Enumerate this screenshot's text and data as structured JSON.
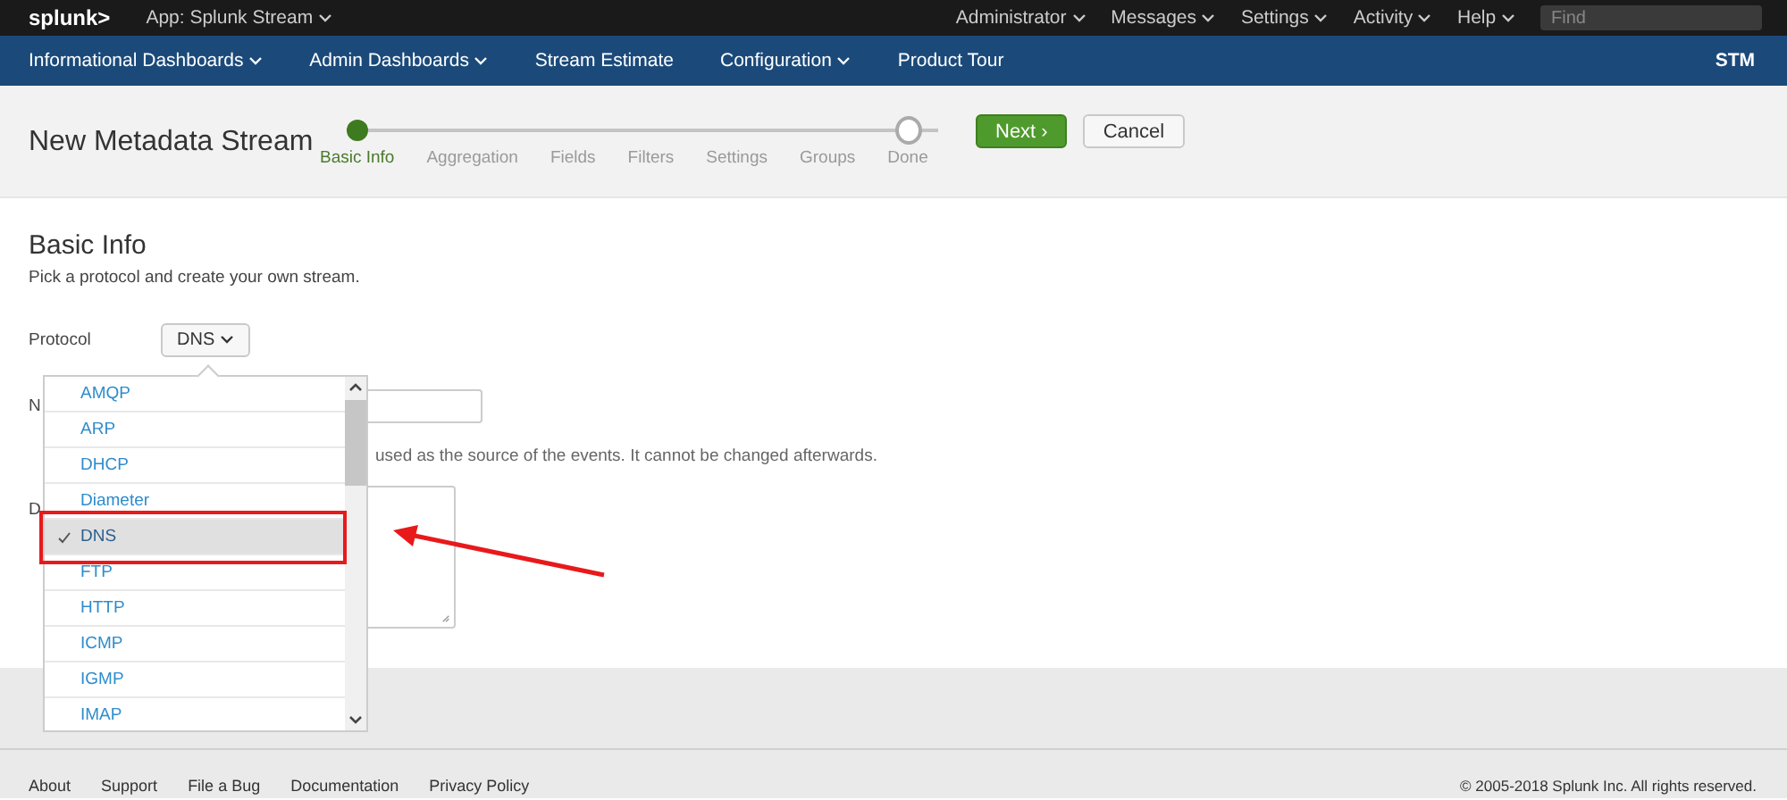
{
  "top_bar": {
    "logo": "splunk>",
    "app": "App: Splunk Stream",
    "menus": [
      "Administrator",
      "Messages",
      "Settings",
      "Activity",
      "Help"
    ],
    "search": {
      "placeholder": "Find"
    }
  },
  "nav": {
    "items": [
      {
        "label": "Informational Dashboards",
        "dropdown": true
      },
      {
        "label": "Admin Dashboards",
        "dropdown": true
      },
      {
        "label": "Stream Estimate",
        "dropdown": false
      },
      {
        "label": "Configuration",
        "dropdown": true
      },
      {
        "label": "Product Tour",
        "dropdown": false
      }
    ],
    "badge": "STM"
  },
  "header": {
    "title": "New Metadata Stream",
    "steps": [
      {
        "label": "Basic Info",
        "selected": true
      },
      {
        "label": "Aggregation",
        "selected": false
      },
      {
        "label": "Fields",
        "selected": false
      },
      {
        "label": "Filters",
        "selected": false
      },
      {
        "label": "Settings",
        "selected": false
      },
      {
        "label": "Groups",
        "selected": false
      },
      {
        "label": "Done",
        "selected": false
      }
    ],
    "buttons": [
      {
        "label": "Next ›",
        "kind": "primary"
      },
      {
        "label": "Cancel",
        "kind": "default"
      }
    ]
  },
  "form": {
    "title": "Basic Info",
    "subtitle": "Pick a protocol and create your own stream.",
    "protocol_label": "Protocol",
    "protocol_value": "DNS",
    "name_label": "N",
    "name_help": "used as the source of the events. It cannot be changed afterwards.",
    "description_label": "D"
  },
  "dropdown": {
    "items": [
      {
        "label": "AMQP",
        "selected": false
      },
      {
        "label": "ARP",
        "selected": false
      },
      {
        "label": "DHCP",
        "selected": false
      },
      {
        "label": "Diameter",
        "selected": false
      },
      {
        "label": "DNS",
        "selected": true
      },
      {
        "label": "FTP",
        "selected": false
      },
      {
        "label": "HTTP",
        "selected": false
      },
      {
        "label": "ICMP",
        "selected": false
      },
      {
        "label": "IGMP",
        "selected": false
      },
      {
        "label": "IMAP",
        "selected": false
      }
    ]
  },
  "footer": {
    "links": [
      "About",
      "Support",
      "File a Bug",
      "Documentation",
      "Privacy Policy"
    ],
    "copyright": "© 2005-2018 Splunk Inc. All rights reserved."
  }
}
